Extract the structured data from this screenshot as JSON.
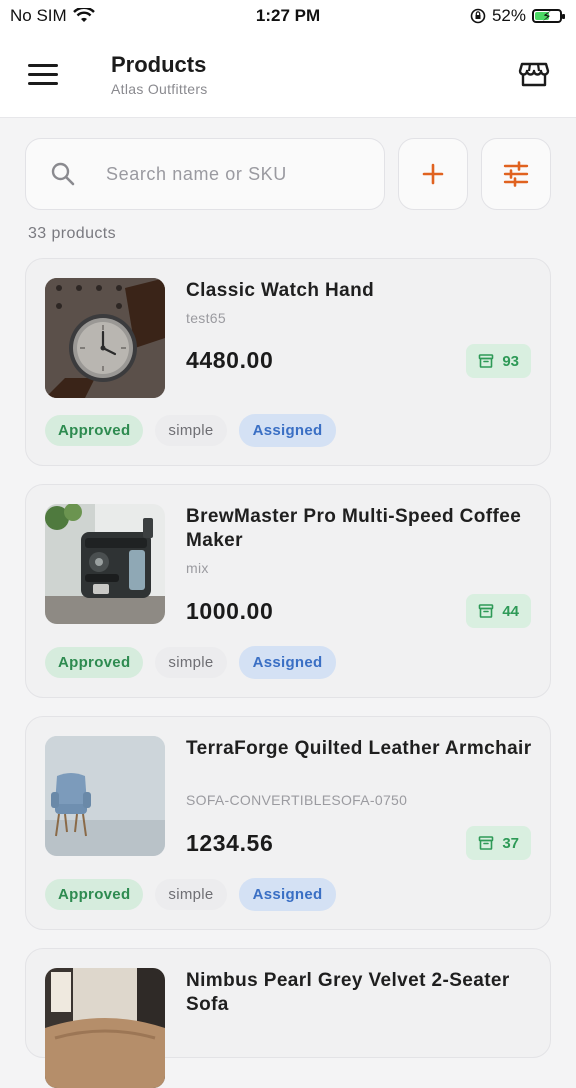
{
  "status": {
    "carrier": "No SIM",
    "time": "1:27 PM",
    "battery": "52%",
    "battery_level": 0.52
  },
  "header": {
    "title": "Products",
    "subtitle": "Atlas Outfitters",
    "menu_icon": "hamburger-menu-icon",
    "store_icon": "storefront-icon"
  },
  "search": {
    "placeholder": "Search name or SKU",
    "value": ""
  },
  "toolbar": {
    "add_icon": "plus-icon",
    "filter_icon": "sliders-icon",
    "accent": "#e0621f"
  },
  "list": {
    "count_label": "33 products"
  },
  "products": [
    {
      "name": "Classic Watch Hand",
      "sku": "test65",
      "price": "4480.00",
      "stock": "93",
      "status": "Approved",
      "type": "simple",
      "assignment": "Assigned",
      "thumb": "wristwatch-photo"
    },
    {
      "name": "BrewMaster Pro Multi-Speed Coffee Maker",
      "sku": "mix",
      "price": "1000.00",
      "stock": "44",
      "status": "Approved",
      "type": "simple",
      "assignment": "Assigned",
      "thumb": "espresso-machine-photo"
    },
    {
      "name": "TerraForge Quilted Leather Armchair",
      "sku": "SOFA-CONVERTIBLESOFA-0750",
      "price": "1234.56",
      "stock": "37",
      "status": "Approved",
      "type": "simple",
      "assignment": "Assigned",
      "thumb": "armchair-photo"
    },
    {
      "name": "Nimbus Pearl Grey Velvet 2-Seater Sofa",
      "thumb": "sofa-photo"
    }
  ],
  "colors": {
    "approved_bg": "#d6ecdd",
    "approved_text": "#2e8b50",
    "assigned_bg": "#d4e1f4",
    "assigned_text": "#3a6fc4",
    "stock_bg": "#d9efe0",
    "stock_text": "#2e9a57"
  }
}
